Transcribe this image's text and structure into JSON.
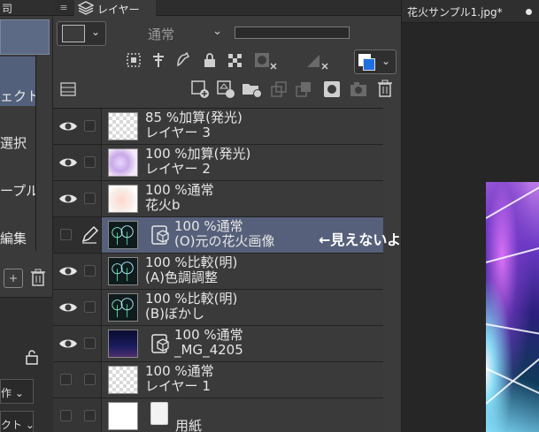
{
  "left_panel": {
    "header": "司",
    "items": [
      "ェクト",
      "選択",
      "ープル",
      "編集"
    ],
    "bottom_selects": [
      "作",
      "クト"
    ]
  },
  "layer_panel": {
    "tab_label": "レイヤー",
    "blend_mode": "通常",
    "annotation": "←見えないように",
    "layers": [
      {
        "line1": "85 %加算(発光)",
        "line2": "レイヤー 3",
        "visible": true,
        "thumb": "checker"
      },
      {
        "line1": "100 %加算(発光)",
        "line2": "レイヤー 2",
        "visible": true,
        "thumb": "fireworks-purple"
      },
      {
        "line1": "100 %通常",
        "line2": "花火b",
        "visible": true,
        "thumb": "fireworks-peach"
      },
      {
        "line1": "100 %通常",
        "line2": "(O)元の花火画像",
        "visible": false,
        "selected": true,
        "thumb": "fireworks-dark",
        "reference": true
      },
      {
        "line1": "100 %比較(明)",
        "line2": "(A)色調調整",
        "visible": true,
        "thumb": "fireworks-dark"
      },
      {
        "line1": "100 %比較(明)",
        "line2": "(B)ぼかし",
        "visible": true,
        "thumb": "fireworks-dark"
      },
      {
        "line1": "100 %通常",
        "line2": "_MG_4205",
        "visible": true,
        "thumb": "night-sky",
        "reference": true
      },
      {
        "line1": "100 %通常",
        "line2": "レイヤー 1",
        "visible": false,
        "thumb": "checker"
      },
      {
        "line1": "",
        "line2": "用紙",
        "visible": false,
        "thumb": "white",
        "paper": true
      }
    ],
    "colors": {
      "accent": "#1f6fe0",
      "selected_row": "#56607a"
    }
  },
  "canvas": {
    "tab_label": "花火サンプル1.jpg*"
  }
}
